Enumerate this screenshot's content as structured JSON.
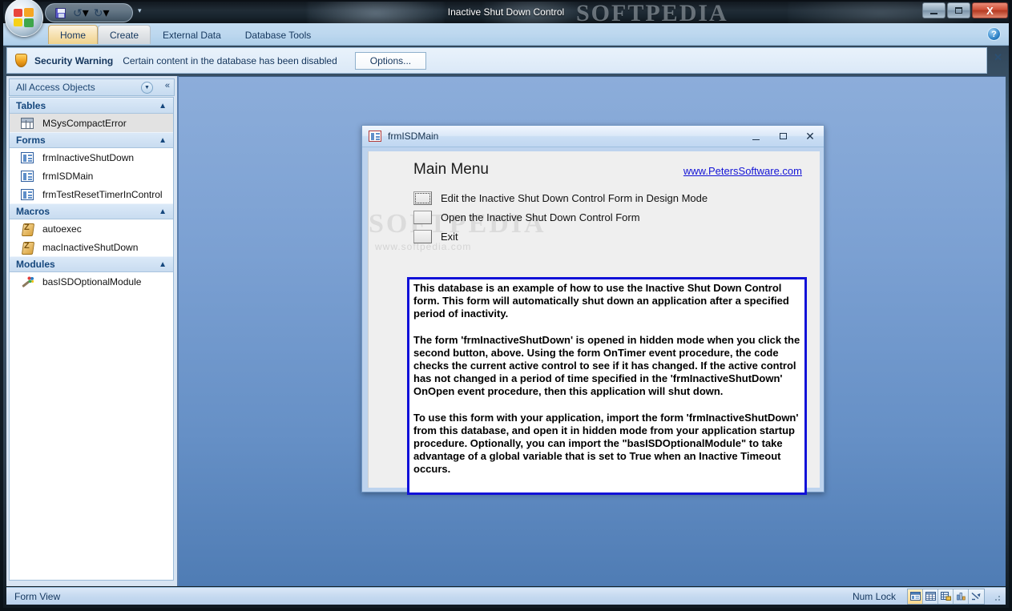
{
  "window": {
    "title": "Inactive Shut Down Control",
    "watermark": "SOFTPEDIA",
    "minimize_label": "Minimize",
    "maximize_label": "Maximize",
    "close_label": "X"
  },
  "quick_access": {
    "save_label": "Save",
    "undo_label": "Undo",
    "redo_label": "Redo",
    "undo_caret": "▾",
    "redo_caret": "▾",
    "customize_label": "▾"
  },
  "office_button": {
    "label": "Office Button"
  },
  "ribbon": {
    "tabs": [
      {
        "label": "Home",
        "state": "active"
      },
      {
        "label": "Create",
        "state": "hover"
      },
      {
        "label": "External Data",
        "state": "normal"
      },
      {
        "label": "Database Tools",
        "state": "normal"
      }
    ],
    "help_label": "?"
  },
  "security_bar": {
    "title": "Security Warning",
    "message": "Certain content in the database has been disabled",
    "button_label": "Options...",
    "close_label": "✕"
  },
  "nav_pane": {
    "header": "All Access Objects",
    "dropdown_glyph": "▼",
    "collapse_glyph": "«",
    "groups": [
      {
        "label": "Tables",
        "chevron": "▲",
        "items": [
          {
            "label": "MSysCompactError",
            "icon": "table-icon",
            "selected": true
          }
        ]
      },
      {
        "label": "Forms",
        "chevron": "▲",
        "items": [
          {
            "label": "frmInactiveShutDown",
            "icon": "form-icon",
            "selected": false
          },
          {
            "label": "frmISDMain",
            "icon": "form-icon",
            "selected": false
          },
          {
            "label": "frmTestResetTimerInControl",
            "icon": "form-icon",
            "selected": false
          }
        ]
      },
      {
        "label": "Macros",
        "chevron": "▲",
        "items": [
          {
            "label": "autoexec",
            "icon": "macro-icon",
            "selected": false
          },
          {
            "label": "macInactiveShutDown",
            "icon": "macro-icon",
            "selected": false
          }
        ]
      },
      {
        "label": "Modules",
        "chevron": "▲",
        "items": [
          {
            "label": "basISDOptionalModule",
            "icon": "module-icon",
            "selected": false
          }
        ]
      }
    ]
  },
  "form_window": {
    "title": "frmISDMain",
    "minimize_glyph": "_",
    "restore_glyph": "□",
    "close_glyph": "✕",
    "heading": "Main Menu",
    "link": "www.PetersSoftware.com",
    "watermark": "SOFTPEDIA",
    "watermark_sub": "www.softpedia.com",
    "menu_items": [
      {
        "label": "Edit the Inactive Shut Down Control Form in Design Mode",
        "focused": true
      },
      {
        "label": "Open the Inactive Shut Down Control Form",
        "focused": false
      },
      {
        "label": "Exit",
        "focused": false
      }
    ],
    "description_paragraphs": [
      "This database is an example of how to use the Inactive Shut Down Control form. This form will automatically shut down an application after a specified period of inactivity.",
      "The form 'frmInactiveShutDown' is opened in hidden mode when you click the second button, above. Using the form OnTimer event procedure, the code checks the current active control to see if it has changed. If the active control has not changed in a period of time specified in the 'frmInactiveShutDown' OnOpen event procedure, then this application will shut down.",
      "To use this form with your application, import the form 'frmInactiveShutDown' from this database, and open it in hidden mode from your application startup procedure. Optionally, you can import the \"basISDOptionalModule\" to take advantage of a global variable that is set to True when an Inactive Timeout occurs."
    ]
  },
  "status_bar": {
    "view_label": "Form View",
    "num_lock": "Num Lock",
    "view_buttons": [
      {
        "name": "form-view-button",
        "active": true
      },
      {
        "name": "datasheet-view-button",
        "active": false
      },
      {
        "name": "pivottable-view-button",
        "active": false
      },
      {
        "name": "pivotchart-view-button",
        "active": false
      },
      {
        "name": "layout-view-button",
        "active": false
      }
    ]
  },
  "colors": {
    "accent_blue": "#1414d6",
    "ribbon_blue": "#bdd8ef",
    "active_tab": "#f7e3b6",
    "desktop_top": "#8cadda",
    "desktop_bottom": "#4f7cb4",
    "desc_border": "#1111d8"
  }
}
